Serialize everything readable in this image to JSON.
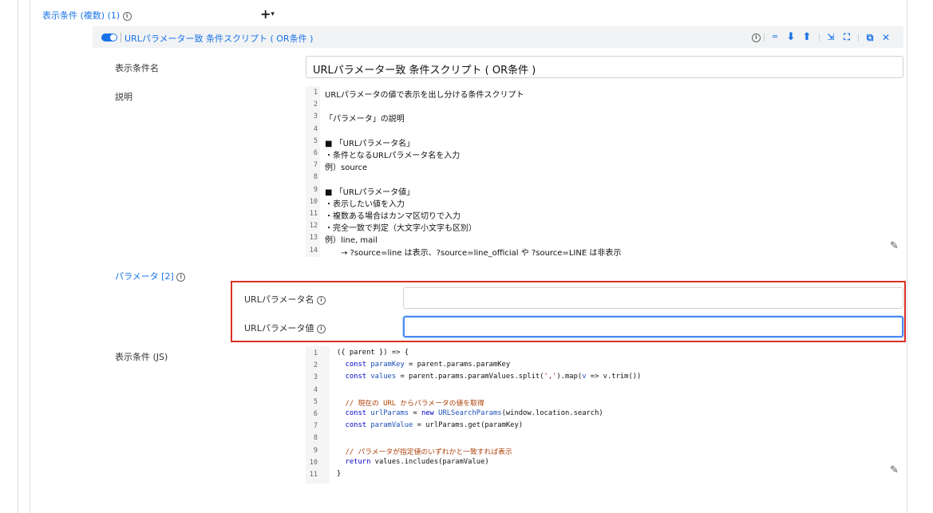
{
  "header": {
    "conditions_title": "表示条件 (複数) (1)",
    "add_button": "+",
    "add_chevron": "▾"
  },
  "condition": {
    "toggle_on": true,
    "title": "URLパラメーター致 条件スクリプト ( OR条件 )",
    "toolbar": {
      "info": "i",
      "menu": "═",
      "down": "⬇",
      "up": "⬆",
      "collapse": "⇲",
      "expand": "⛶",
      "copy": "⧉",
      "close": "✕"
    },
    "name_label": "表示条件名",
    "name_value": "URLパラメーター致 条件スクリプト ( OR条件 )",
    "description_label": "説明",
    "description_lines": [
      "URLパラメータの値で表示を出し分ける条件スクリプト",
      "",
      "「パラメータ」の説明",
      "",
      "■ 「URLパラメータ名」",
      "・条件となるURLパラメータ名を入力",
      "例）source",
      "",
      "■ 「URLパラメータ値」",
      "・表示したい値を入力",
      "・複数ある場合はカンマ区切りで入力",
      "・完全一致で判定（大文字小文字も区別）",
      "例）line, mail",
      "　　→ ?source=line は表示、?source=line_official や ?source=LINE は非表示"
    ],
    "params_label": "パラメータ [2]",
    "param_name_label": "URLパラメータ名",
    "param_name_value": "",
    "param_value_label": "URLパラメータ値",
    "param_value_value": "",
    "js_label": "表示条件 (JS)",
    "js_lines": [
      "({ parent }) => {",
      "  const paramKey = parent.params.paramKey",
      "  const values = parent.params.paramValues.split(',').map(v => v.trim())",
      "",
      "  // 現在の URL からパラメータの値を取得",
      "  const urlParams = new URLSearchParams(window.location.search)",
      "  const paramValue = urlParams.get(paramKey)",
      "",
      "  // パラメータが指定値のいずれかと一致すれば表示",
      "  return values.includes(paramValue)",
      "}"
    ],
    "line_numbers": [
      "1",
      "2",
      "3",
      "4",
      "5",
      "6",
      "7",
      "8",
      "9",
      "10",
      "11",
      "12",
      "13",
      "14"
    ],
    "edit_icon": "✎"
  },
  "colors": {
    "accent": "#1a73e8",
    "highlight_border": "#d93025",
    "header_bg": "#f1f3f4"
  }
}
